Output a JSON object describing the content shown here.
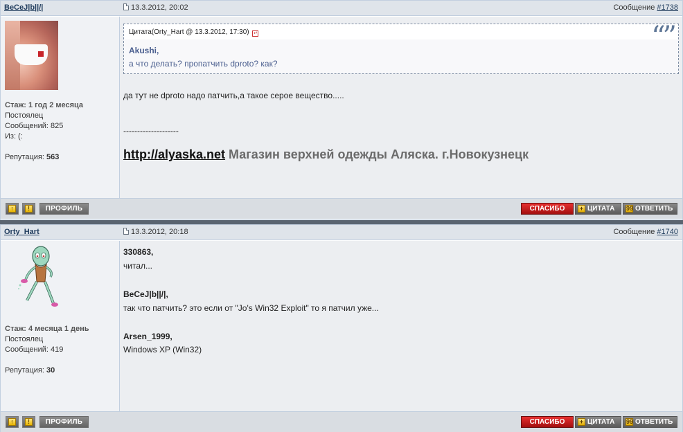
{
  "posts": [
    {
      "author": "BeCeJ|b||/|",
      "date": "13.3.2012, 20:02",
      "number_label": "Сообщение ",
      "number_link": "#1738",
      "user": {
        "tenure_label": "Стаж: 1 год 2 месяца",
        "rank": "Постоялец",
        "messages": "Сообщений: 825",
        "from": "Из: (:",
        "reputation_label": "Репутация: ",
        "reputation_value": "563"
      },
      "quote": {
        "header": "Цитата(Orty_Hart @ 13.3.2012, 17:30)",
        "back_icon": "↵",
        "marks": "“”",
        "author": "Akushi,",
        "text": "а что делать? пропатчить dproto? как?"
      },
      "text": "да тут не dproto надо патчить,а такое серое вещество.....",
      "separator": "--------------------",
      "signature_link": "http://alyaska.net",
      "signature_text": " Магазин верхней одежды Аляска. г.Новокузнецк"
    },
    {
      "author": "Orty_Hart",
      "date": "13.3.2012, 20:18",
      "number_label": "Сообщение ",
      "number_link": "#1740",
      "user": {
        "tenure_label": "Стаж: 4 месяца 1 день",
        "rank": "Постоялец",
        "messages": "Сообщений: 419",
        "reputation_label": "Репутация: ",
        "reputation_value": "30"
      },
      "blocks": [
        {
          "mention": "330863,",
          "reply": "читал..."
        },
        {
          "mention": "BeCeJ|b||/|,",
          "reply": "так что патчить? это если от \"Jo's Win32 Exploit\" то я патчил уже..."
        },
        {
          "mention": "Arsen_1999,",
          "reply": "Windows XP (Win32)"
        }
      ]
    }
  ],
  "footer": {
    "profile": "ПРОФИЛЬ",
    "thanks": "СПАСИБО",
    "quote": "ЦИТАТА",
    "reply": "ОТВЕТИТЬ",
    "up_icon": "arrow-up-icon",
    "warn_icon": "exclamation-icon",
    "up_glyph": "↑",
    "warn_glyph": "!",
    "quote_glyph": "+",
    "reply_glyph": "99"
  },
  "colors": {
    "header_bg": "#dfe4ea",
    "link": "#1f3b5c",
    "thanks_red": "#c81a1a",
    "quote_text": "#4b5f8f"
  }
}
